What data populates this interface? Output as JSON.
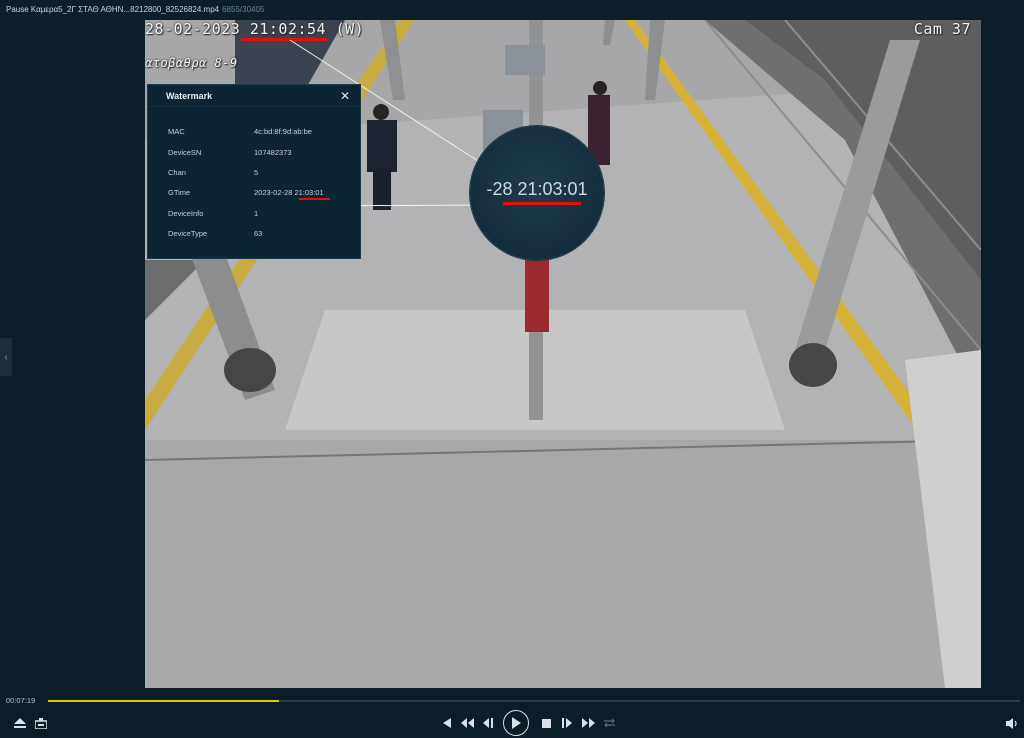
{
  "window": {
    "title": "Pause Καμερα5_2Γ ΣΤΑΘ ΑΘΗΝ...8212800_82526824.mp4",
    "frames": "6855/30405"
  },
  "osd": {
    "datetime": "28-02-2023 21:02:54 (W)",
    "camera": "Cam 37",
    "location": "ατοβαθρα 8-9"
  },
  "watermark": {
    "title": "Watermark",
    "close": "✕",
    "rows": [
      {
        "label": "MAC",
        "value": "4c:bd:8f:9d:ab:be"
      },
      {
        "label": "DeviceSN",
        "value": "107482373"
      },
      {
        "label": "Chan",
        "value": "5"
      },
      {
        "label": "GTime",
        "value": "2023-02-28 21:03:01"
      },
      {
        "label": "DeviceInfo",
        "value": "1"
      },
      {
        "label": "DeviceType",
        "value": "63"
      }
    ]
  },
  "magnifier": {
    "text": "-28 21:03:01"
  },
  "playback": {
    "elapsed": "00:07:19",
    "progress_fraction": 0.2375,
    "accent_color": "#e3c21a"
  },
  "icons": {
    "side_toggle": "chevron-left-icon",
    "eject": "eject-icon",
    "clip": "clip-icon",
    "frame_back": "step-back-icon",
    "rewind": "rewind-icon",
    "slow": "slow-icon",
    "play": "play-icon",
    "stop": "stop-icon",
    "step_forward": "step-forward-icon",
    "fast_forward": "fast-forward-icon",
    "sync": "sync-icon",
    "volume": "volume-icon"
  }
}
